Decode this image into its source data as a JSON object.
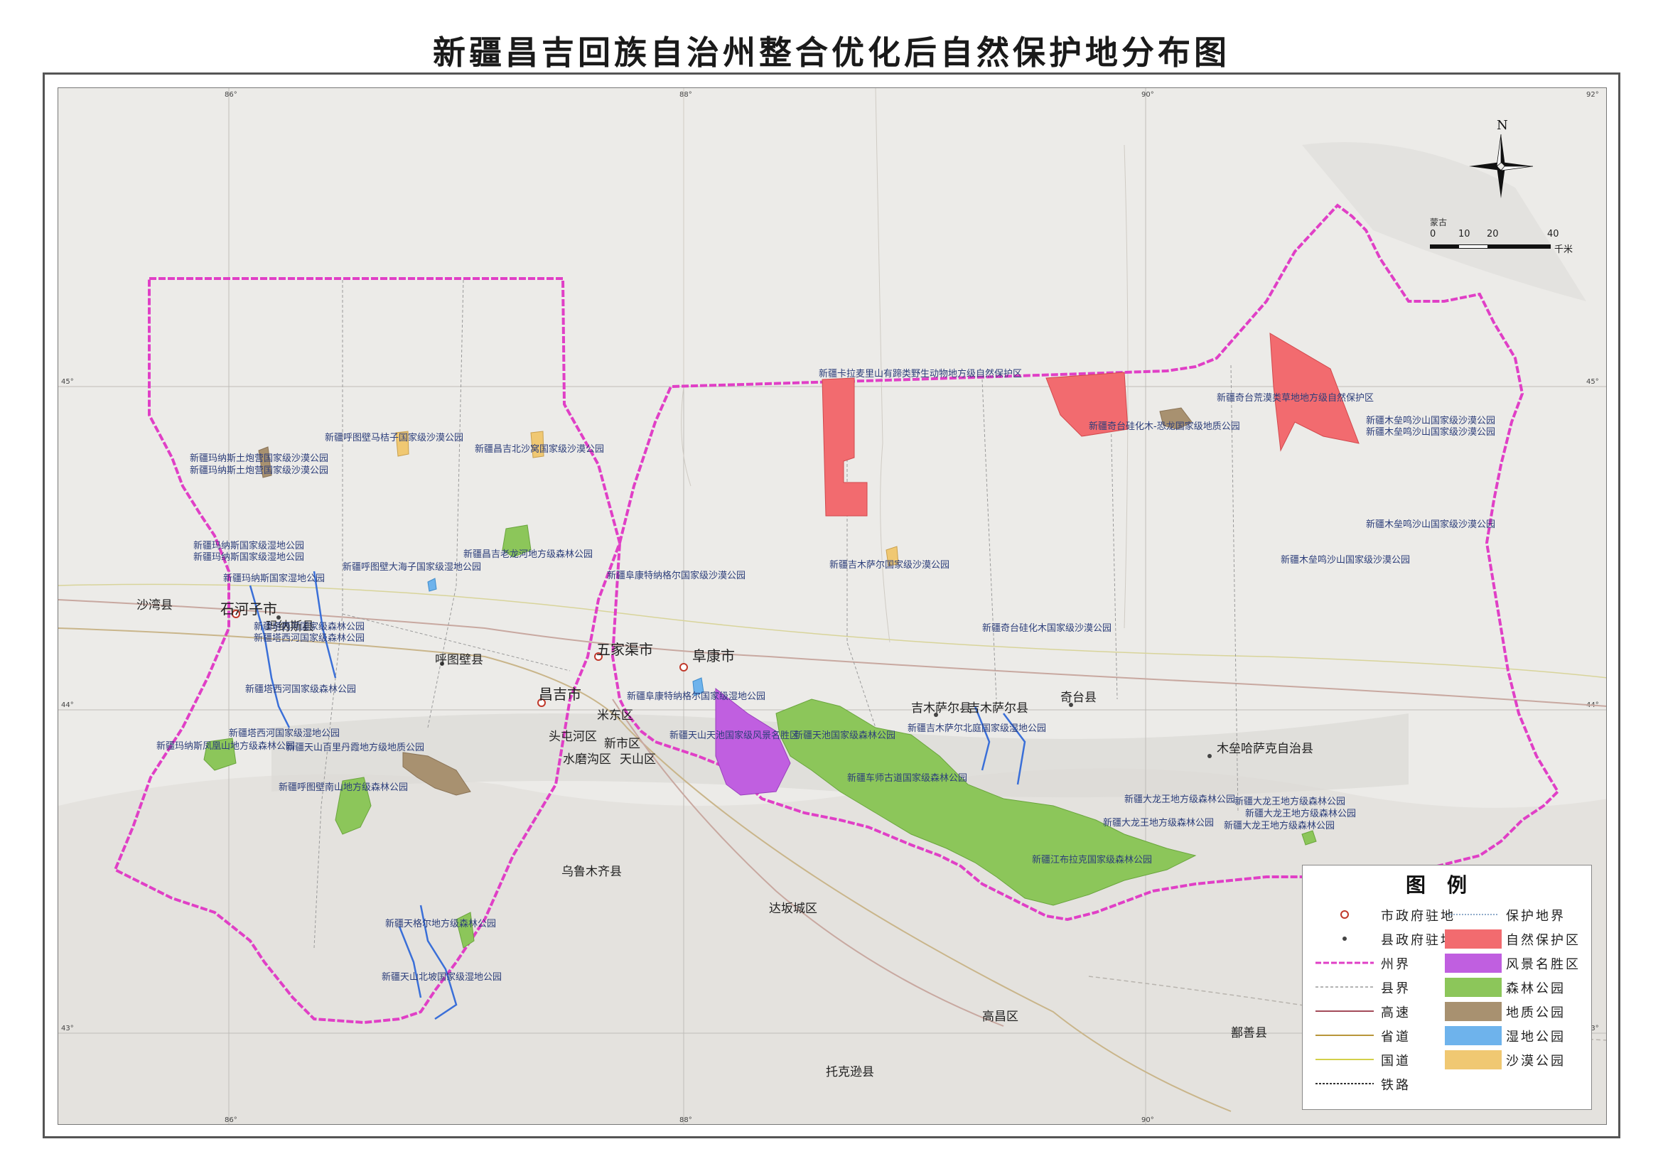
{
  "title": "新疆昌吉回族自治州整合优化后自然保护地分布图",
  "graticule": {
    "lon_labels": [
      "86°",
      "88°",
      "90°",
      "92°"
    ],
    "lat_labels": [
      "45°",
      "44°",
      "43°"
    ]
  },
  "north_arrow": {
    "label": "N",
    "icon": "north-arrow-icon"
  },
  "scale_bar": {
    "country_label": "蒙古",
    "ticks": [
      "0",
      "10",
      "20",
      "40"
    ],
    "unit": "千米"
  },
  "cities": {
    "shawan": "沙湾县",
    "shihezi": "石河子市",
    "manas": "玛纳斯县",
    "hutubi": "呼图壁县",
    "changji": "昌吉市",
    "wujiaqu": "五家渠市",
    "fukang": "阜康市",
    "midong": "米东区",
    "toutunhe": "头屯河区",
    "xinshi": "新市区",
    "tianshan": "天山区",
    "shuimogou": "水磨沟区",
    "wulumuqi_county": "乌鲁木齐县",
    "dabancheng": "达坂城区",
    "jimsar": "吉木萨尔县",
    "jimsar_dup": "吉木萨尔县",
    "qitai": "奇台县",
    "mulei": "木垒哈萨克自治县",
    "gaochang": "高昌区",
    "shanshan": "鄯善县",
    "tuokexun": "托克逊县"
  },
  "reserves": {
    "kalamaili": "新疆卡拉麦里山有蹄类野生动物地方级自然保护区",
    "qitai_huangmo": "新疆奇台荒漠类草地地方级自然保护区",
    "qitai_gh": "新疆奇台硅化木-恐龙国家级地质公园",
    "mulei_shashan1": "新疆木垒鸣沙山国家级沙漠公园",
    "mulei_shashan2": "新疆木垒鸣沙山国家级沙漠公园",
    "mulei_shashan3": "新疆木垒鸣沙山国家级沙漠公园",
    "mulei_shashan4": "新疆木垒鸣沙山国家级沙漠公园",
    "hutubi_mazi": "新疆呼图壁马桔子国家级沙漠公园",
    "changji_beisha": "新疆昌吉北沙窝国家级沙漠公园",
    "manas_tupao1": "新疆玛纳斯土炮营国家级沙漠公园",
    "manas_tupao2": "新疆玛纳斯土炮营国家级沙漠公园",
    "manas_wet1": "新疆玛纳斯国家级湿地公园",
    "manas_wet2": "新疆玛纳斯国家级湿地公园",
    "manas_wet3": "新疆玛纳斯国家湿地公园",
    "hutubi_dahaizi": "新疆呼图壁大海子国家级湿地公园",
    "changji_laolong": "新疆昌吉老龙河地方级森林公园",
    "fukang_tenggeli": "新疆阜康特纳格尔国家级沙漠公园",
    "jimsar_sha": "新疆吉木萨尔国家级沙漠公园",
    "qitai_gh_sha": "新疆奇台硅化木国家级沙漠公园",
    "taxi1": "新疆塔西河国家级森林公园",
    "taxi2": "新疆塔西河国家级森林公园",
    "taxi3": "新疆塔西河国家级森林公园",
    "taxi4": "新疆塔西河国家级湿地公园",
    "manas_fenghuang": "新疆玛纳斯凤凰山地方级森林公园",
    "tianshan_baili": "新疆天山百里丹霞地方级地质公园",
    "hutubi_nanshan": "新疆呼图壁南山地方级森林公园",
    "fukang_tenggeer_wet": "新疆阜康特纳格尔国家级湿地公园",
    "tianchi": "新疆天山天池国家级风景名胜区",
    "tianshan_tianchi_forest": "新疆天池国家级森林公园",
    "chegu": "新疆车师古道国家级森林公园",
    "jimsar_beiting": "新疆吉木萨尔北庭国家级湿地公园",
    "dalong1": "新疆大龙王地方级森林公园",
    "dalong2": "新疆大龙王地方级森林公园",
    "dalong3": "新疆大龙王地方级森林公园",
    "dalong4": "新疆大龙王地方级森林公园",
    "dalong5": "新疆大龙王地方级森林公园",
    "jiangbulake": "新疆江布拉克国家级森林公园",
    "tiange": "新疆天格尔地方级森林公园",
    "tianshan_beipo": "新疆天山北坡国家级湿地公园"
  },
  "legend": {
    "title": "图例",
    "items": [
      {
        "label": "市政府驻地",
        "symbol": "city-seat"
      },
      {
        "label": "县政府驻地",
        "symbol": "county-seat"
      },
      {
        "label": "州界",
        "symbol": "prefecture-boundary"
      },
      {
        "label": "县界",
        "symbol": "county-boundary"
      },
      {
        "label": "高速",
        "symbol": "expressway"
      },
      {
        "label": "省道",
        "symbol": "provincial-road"
      },
      {
        "label": "国道",
        "symbol": "national-road"
      },
      {
        "label": "铁路",
        "symbol": "railway"
      }
    ],
    "categories": [
      {
        "label": "保护地界",
        "color": "#6a8fb8",
        "symbol": "reserve-boundary"
      },
      {
        "label": "自然保护区",
        "color": "#f26b6f"
      },
      {
        "label": "风景名胜区",
        "color": "#c05fe0"
      },
      {
        "label": "森林公园",
        "color": "#8cc65a"
      },
      {
        "label": "地质公园",
        "color": "#a89170"
      },
      {
        "label": "湿地公园",
        "color": "#6eb3ec"
      },
      {
        "label": "沙漠公园",
        "color": "#f0c872"
      }
    ]
  },
  "colors": {
    "prefecture_boundary": "#e03fc6",
    "nature_reserve": "#f26b6f",
    "scenic_area": "#c05fe0",
    "forest_park": "#8cc65a",
    "geo_park": "#a89170",
    "wetland_park": "#6eb3ec",
    "desert_park": "#f0c872",
    "river": "#3a6fd8"
  }
}
